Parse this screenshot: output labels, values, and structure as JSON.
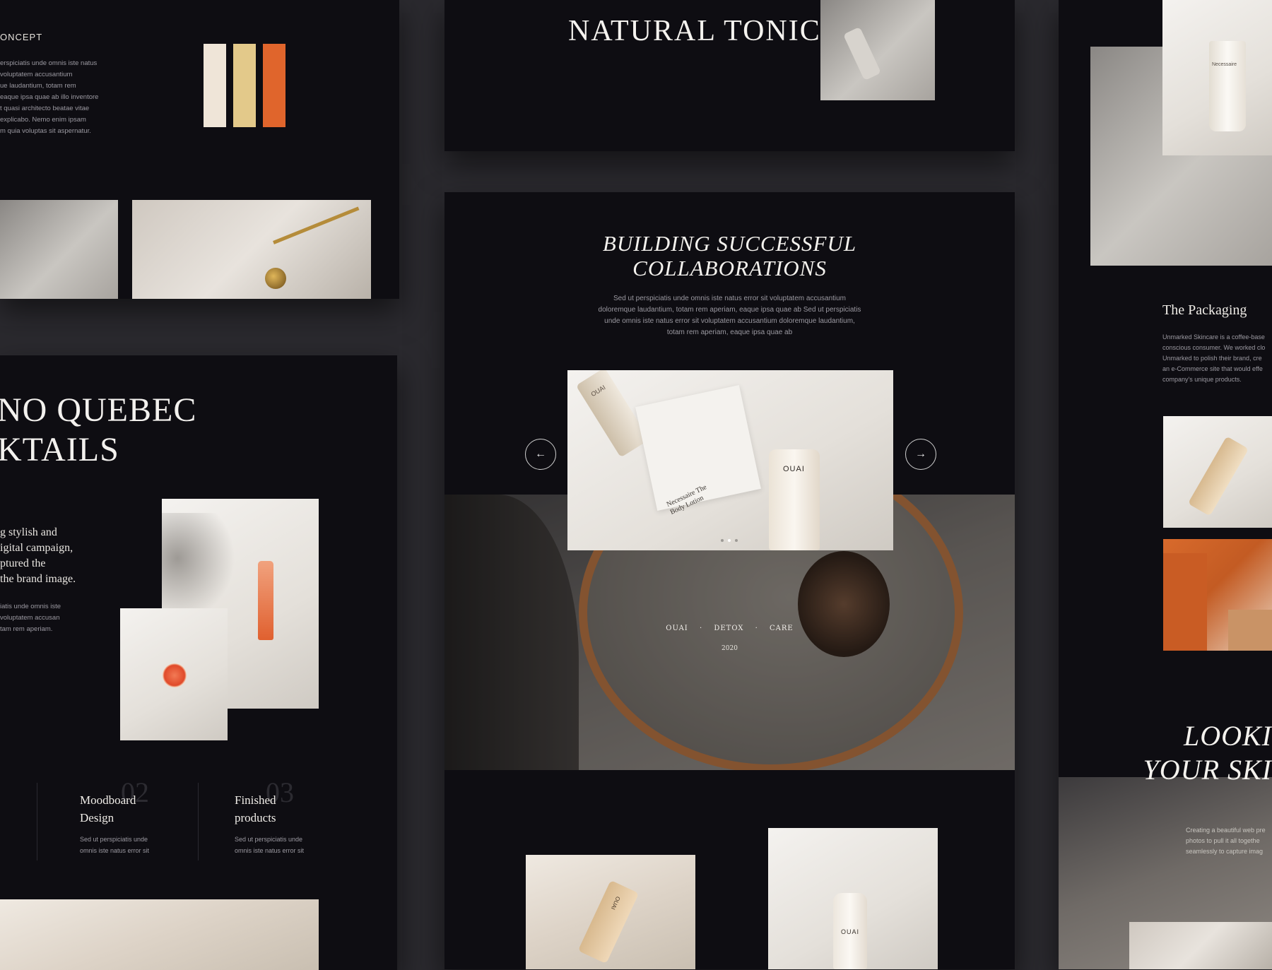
{
  "left_top": {
    "section_label": "ONCEPT",
    "body_lines": [
      "erspiciatis unde omnis iste natus",
      "voluptatem accusantium",
      "ue laudantium, totam rem",
      "eaque ipsa quae ab illo inventore",
      "t quasi architecto beatae vitae",
      "explicabo. Nemo enim ipsam",
      "m quia voluptas sit aspernatur."
    ],
    "swatches": [
      "#efe5d8",
      "#e3c98a",
      "#e0652c"
    ]
  },
  "left_bottom": {
    "title_lines": [
      "NO QUEBEC",
      "KTAILS"
    ],
    "intro_lines": [
      "g stylish and",
      "igital campaign,",
      "ptured the",
      "the brand image."
    ],
    "body_lines": [
      "iatis unde omnis iste",
      "voluptatem accusan",
      "tam rem aperiam."
    ],
    "features": [
      {
        "number": "02",
        "title_lines": [
          "Moodboard",
          "Design"
        ],
        "desc_lines": [
          "Sed ut perspiciatis unde",
          "omnis iste natus error sit"
        ]
      },
      {
        "number": "03",
        "title_lines": [
          "Finished",
          "products"
        ],
        "desc_lines": [
          "Sed ut perspiciatis unde",
          "omnis iste natus error sit"
        ]
      }
    ]
  },
  "center_top": {
    "title": "NATURAL TONIC"
  },
  "center_main": {
    "title_lines": [
      "BUILDING SUCCESSFUL",
      "COLLABORATIONS"
    ],
    "body_lines": [
      "Sed ut perspiciatis unde omnis iste natus error sit voluptatem accusantium",
      "doloremque laudantium, totam rem aperiam, eaque ipsa quae ab Sed ut perspiciatis",
      "unde omnis iste natus error sit voluptatem accusantium doloremque laudantium,",
      "totam rem aperiam, eaque ipsa quae ab"
    ],
    "prev_arrow": "←",
    "next_arrow": "→",
    "carousel_product_label": "OUAI",
    "carousel_tube_label": "OUAI",
    "carousel_note": "Necessaire The Body Lotion",
    "tags": [
      "OUAI",
      "DETOX",
      "CARE"
    ],
    "separator": "·",
    "year": "2020",
    "bottom_product_labels": [
      "OUAI",
      "OUAI"
    ]
  },
  "right": {
    "packaging_title": "The Packaging",
    "packaging_lines": [
      "Unmarked Skincare is a coffee-base",
      "conscious consumer. We worked clo",
      "Unmarked to polish their brand, cre",
      "an e-Commerce site that would effe",
      "company's unique products."
    ],
    "tube_label": "Necessaire",
    "big_title_lines": [
      "LOOKI",
      "YOUR SKI"
    ],
    "caption_lines": [
      "Creating a beautiful web pre",
      "photos to pull it all togethe",
      "seamlessly to capture imag"
    ]
  }
}
